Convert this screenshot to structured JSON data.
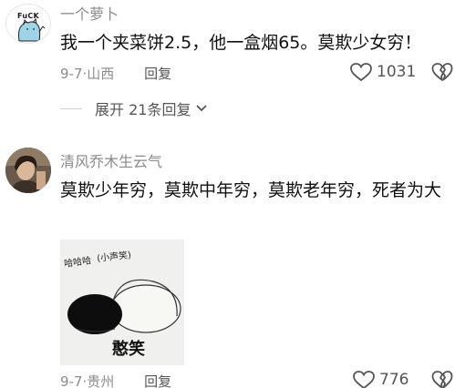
{
  "comments": [
    {
      "username": "一个萝卜",
      "avatar_text": "FuCK",
      "text": "我一个夹菜饼2.5，他一盒烟65。莫欺少女穷！",
      "date": "9-7",
      "location": "山西",
      "reply_label": "回复",
      "likes": "1031",
      "expand_label": "展开 21条回复"
    },
    {
      "username": "清风乔木生云气",
      "text": "莫欺少年穷，莫欺中年穷，莫欺老年穷，死者为大",
      "sticker": {
        "top_text_left": "哈哈哈",
        "top_text_right": "(小声笑)",
        "caption": "憨笑"
      },
      "date": "9-7",
      "location": "贵州",
      "reply_label": "回复",
      "likes": "776"
    }
  ],
  "meta_separator": "·",
  "colors": {
    "text": "#111111",
    "muted": "#8c8c8c",
    "divider": "#cfcfcf"
  }
}
